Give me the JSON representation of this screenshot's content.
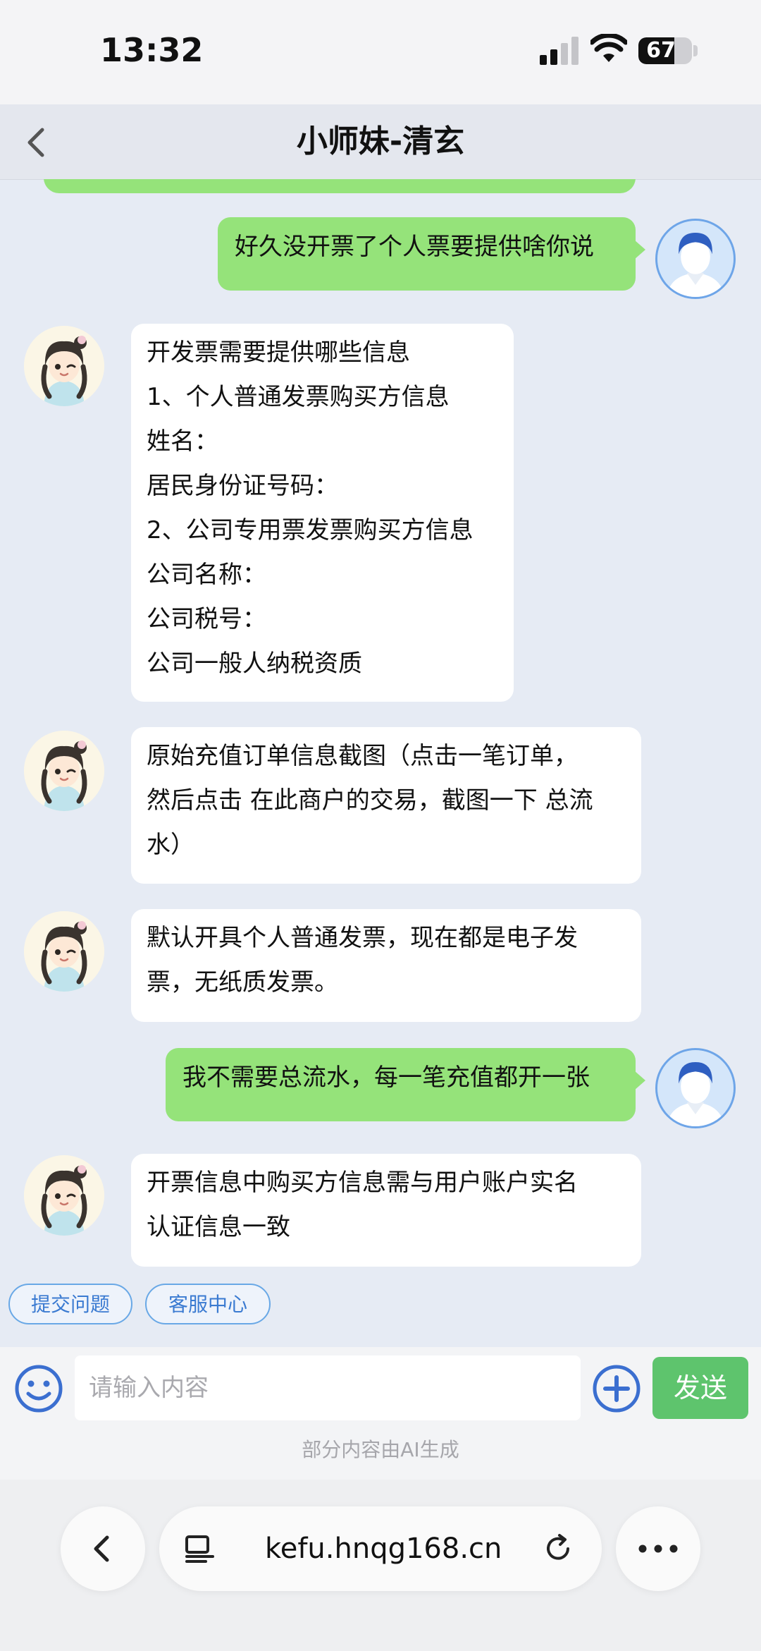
{
  "status_bar": {
    "time": "13:32",
    "battery": "67",
    "battery_level": 0.67
  },
  "header": {
    "title": "小师妹-清玄"
  },
  "messages": [
    {
      "side": "out",
      "lines": [
        "好久没开票了个人票要提供啥你说"
      ]
    },
    {
      "side": "in",
      "lines": [
        "开发票需要提供哪些信息",
        "1、个人普通发票购买方信息",
        "姓名：",
        "居民身份证号码：",
        "2、公司专用票发票购买方信息",
        "公司名称：",
        "公司税号：",
        "公司一般人纳税资质"
      ]
    },
    {
      "side": "in",
      "lines": [
        "原始充值订单信息截图（点击一笔订单，",
        "然后点击 在此商户的交易，截图一下 总流",
        "水）"
      ]
    },
    {
      "side": "in",
      "lines": [
        "默认开具个人普通发票，现在都是电子发",
        "票，无纸质发票。"
      ]
    },
    {
      "side": "out",
      "lines": [
        "我不需要总流水，每一笔充值都开一张"
      ]
    },
    {
      "side": "in",
      "lines": [
        "开票信息中购买方信息需与用户账户实名",
        "认证信息一致"
      ]
    }
  ],
  "quick_buttons": [
    "提交问题",
    "客服中心"
  ],
  "input": {
    "placeholder": "请输入内容",
    "send_label": "发送",
    "ai_note": "部分内容由AI生成"
  },
  "browser": {
    "url": "kefu.hnqg168.cn"
  },
  "colors": {
    "outgoing_bubble": "#95e37a",
    "incoming_bubble": "#ffffff",
    "send_button": "#5ec46d",
    "chat_bg": "#e6ebf4",
    "link_blue": "#3a7ad1"
  }
}
